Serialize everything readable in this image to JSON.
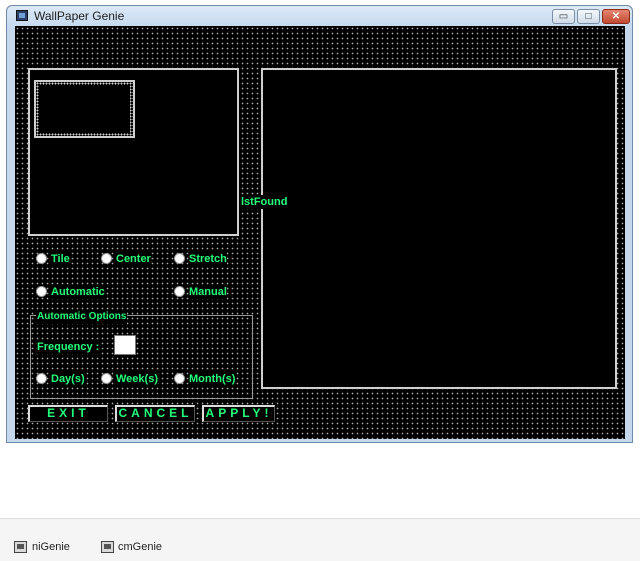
{
  "window": {
    "title": "WallPaper Genie",
    "controls": {
      "minimize": "▭",
      "maximize": "□",
      "close": "✕"
    }
  },
  "preview": {
    "list_label": "lstFound"
  },
  "placement": {
    "tile": "Tile",
    "center": "Center",
    "stretch": "Stretch"
  },
  "mode": {
    "automatic": "Automatic",
    "manual": "Manual"
  },
  "automatic_options": {
    "title": "Automatic Options",
    "frequency_label": "Frequency :",
    "frequency_value": "",
    "units": {
      "days": "Day(s)",
      "weeks": "Week(s)",
      "months": "Month(s)"
    }
  },
  "buttons": {
    "exit": "EXIT",
    "cancel": "CANCEL",
    "apply": "APPLY!"
  },
  "taskbar": {
    "items": [
      "niGenie",
      "cmGenie"
    ]
  },
  "colors": {
    "accent_text": "#22ff7a",
    "client_bg": "#000000",
    "titlebar": "#c6d8ec",
    "close_button": "#c24a33"
  }
}
